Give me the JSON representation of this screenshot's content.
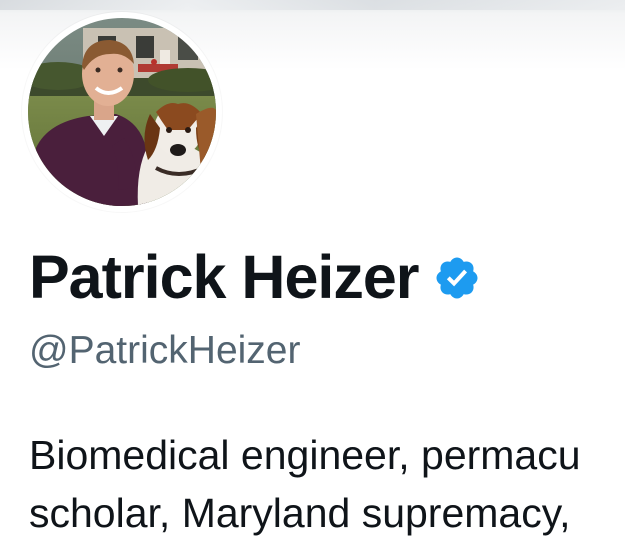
{
  "profile": {
    "display_name": "Patrick Heizer",
    "handle": "@PatrickHeizer",
    "verified": true,
    "bio_lines": [
      "Biomedical engineer, permacu",
      "scholar, Maryland supremacy,"
    ]
  },
  "icons": {
    "verified": "verified-badge-icon"
  },
  "colors": {
    "name_text": "#0f1419",
    "handle_text": "#536471",
    "verified_badge": "#1d9bf0"
  }
}
